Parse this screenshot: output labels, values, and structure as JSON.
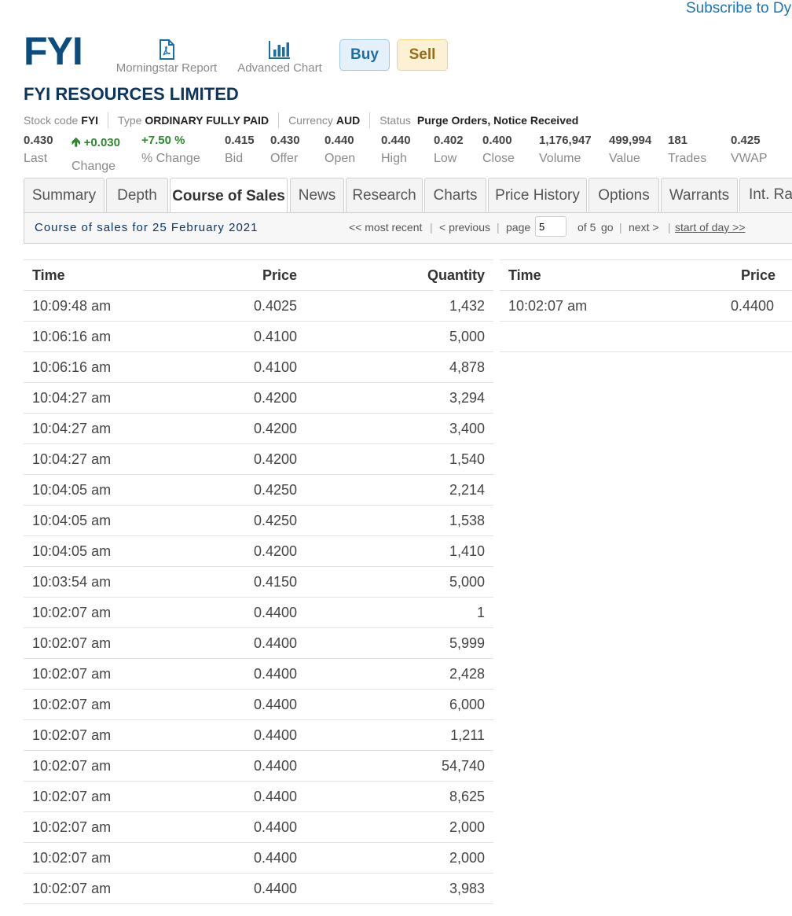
{
  "header": {
    "subscribe_link": "Subscribe to Dyn",
    "ticker": "FYI",
    "report_label": "Morningstar Report",
    "report_icon": "pdf-icon",
    "chart_label": "Advanced Chart",
    "chart_icon": "bar-chart-icon",
    "buy_label": "Buy",
    "sell_label": "Sell",
    "company_name": "FYI RESOURCES LIMITED"
  },
  "meta": {
    "stock_code_label": "Stock code",
    "stock_code": "FYI",
    "type_label": "Type",
    "type": "ORDINARY FULLY PAID",
    "currency_label": "Currency",
    "currency": "AUD",
    "status_label": "Status",
    "status": "Purge Orders, Notice Received"
  },
  "stats": {
    "last": {
      "value": "0.430",
      "label": "Last"
    },
    "change": {
      "value": "+0.030",
      "label": "Change"
    },
    "pct_change": {
      "value": "+7.50 %",
      "label": "% Change"
    },
    "bid": {
      "value": "0.415",
      "label": "Bid"
    },
    "offer": {
      "value": "0.430",
      "label": "Offer"
    },
    "open": {
      "value": "0.440",
      "label": "Open"
    },
    "high": {
      "value": "0.440",
      "label": "High"
    },
    "low": {
      "value": "0.402",
      "label": "Low"
    },
    "close": {
      "value": "0.400",
      "label": "Close"
    },
    "volume": {
      "value": "1,176,947",
      "label": "Volume"
    },
    "value": {
      "value": "499,994",
      "label": "Value"
    },
    "trades": {
      "value": "181",
      "label": "Trades"
    },
    "vwap": {
      "value": "0.425",
      "label": "VWAP"
    }
  },
  "tabs": [
    "Summary",
    "Depth",
    "Course of Sales",
    "News",
    "Research",
    "Charts",
    "Price History",
    "Options",
    "Warrants",
    "Int. Rat"
  ],
  "pager": {
    "title": "Course of sales for 25 February 2021",
    "most_recent": "<< most recent",
    "previous": "< previous",
    "page_label": "page",
    "page_value": "5",
    "of_label": "of 5",
    "go": "go",
    "next": "next >",
    "start_of_day": "start of day >>"
  },
  "table_left": {
    "headers": {
      "time": "Time",
      "price": "Price",
      "quantity": "Quantity"
    },
    "rows": [
      {
        "time": "10:09:48 am",
        "price": "0.4025",
        "quantity": "1,432"
      },
      {
        "time": "10:06:16 am",
        "price": "0.4100",
        "quantity": "5,000"
      },
      {
        "time": "10:06:16 am",
        "price": "0.4100",
        "quantity": "4,878"
      },
      {
        "time": "10:04:27 am",
        "price": "0.4200",
        "quantity": "3,294"
      },
      {
        "time": "10:04:27 am",
        "price": "0.4200",
        "quantity": "3,400"
      },
      {
        "time": "10:04:27 am",
        "price": "0.4200",
        "quantity": "1,540"
      },
      {
        "time": "10:04:05 am",
        "price": "0.4250",
        "quantity": "2,214"
      },
      {
        "time": "10:04:05 am",
        "price": "0.4250",
        "quantity": "1,538"
      },
      {
        "time": "10:04:05 am",
        "price": "0.4200",
        "quantity": "1,410"
      },
      {
        "time": "10:03:54 am",
        "price": "0.4150",
        "quantity": "5,000"
      },
      {
        "time": "10:02:07 am",
        "price": "0.4400",
        "quantity": "1"
      },
      {
        "time": "10:02:07 am",
        "price": "0.4400",
        "quantity": "5,999"
      },
      {
        "time": "10:02:07 am",
        "price": "0.4400",
        "quantity": "2,428"
      },
      {
        "time": "10:02:07 am",
        "price": "0.4400",
        "quantity": "6,000"
      },
      {
        "time": "10:02:07 am",
        "price": "0.4400",
        "quantity": "1,211"
      },
      {
        "time": "10:02:07 am",
        "price": "0.4400",
        "quantity": "54,740"
      },
      {
        "time": "10:02:07 am",
        "price": "0.4400",
        "quantity": "8,625"
      },
      {
        "time": "10:02:07 am",
        "price": "0.4400",
        "quantity": "2,000"
      },
      {
        "time": "10:02:07 am",
        "price": "0.4400",
        "quantity": "2,000"
      },
      {
        "time": "10:02:07 am",
        "price": "0.4400",
        "quantity": "3,983"
      }
    ]
  },
  "table_right": {
    "headers": {
      "time": "Time",
      "price": "Price"
    },
    "rows": [
      {
        "time": "10:02:07 am",
        "price": "0.4400"
      }
    ]
  },
  "colors": {
    "brand": "#0c4d80",
    "link": "#1a75bb",
    "positive": "#2d8a2d",
    "buy_bg": "#e5f1fa",
    "sell_bg": "#fdf1d5"
  }
}
